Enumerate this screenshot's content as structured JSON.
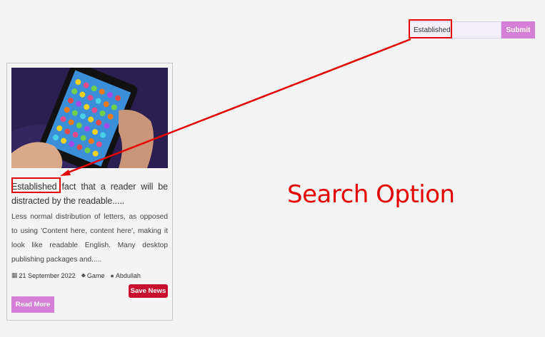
{
  "search": {
    "value": "Established",
    "submit_label": "Submit"
  },
  "card": {
    "image_icon": "phone-candy-game-image",
    "title": "Established fact that a reader will be distracted by the readable.....",
    "excerpt": "Less normal distribution of letters, as opposed to using 'Content here, content here', making it look like readable English. Many desktop publishing packages and.....",
    "meta": {
      "date": "21 September 2022",
      "category": "Game",
      "author": "Abdullah"
    },
    "save_label": "Save News",
    "read_more_label": "Read More"
  },
  "annotation": {
    "label": "Search Option",
    "color": "#e60000"
  },
  "colors": {
    "accent": "#d57fd6",
    "save": "#c8102e",
    "background": "#f4f4f4"
  }
}
